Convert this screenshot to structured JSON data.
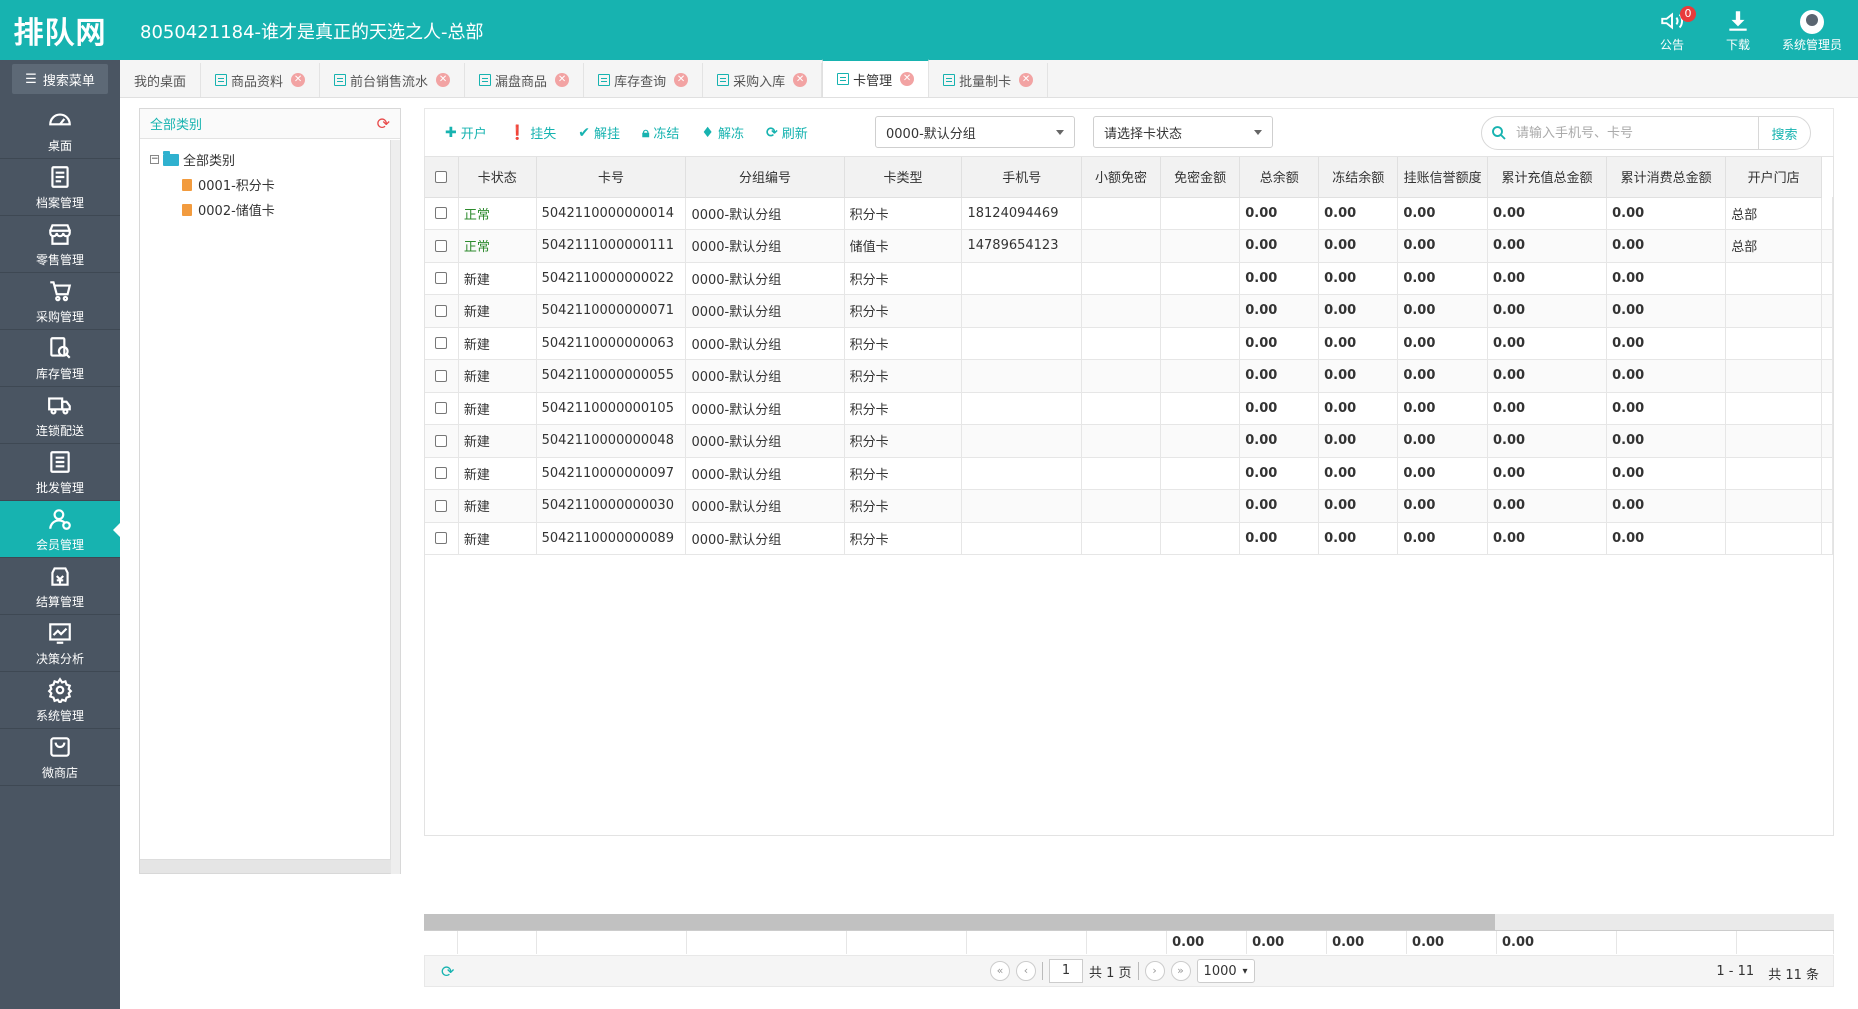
{
  "header": {
    "logo": "排队网",
    "title": "8050421184-谁才是真正的天选之人-总部",
    "actions": [
      {
        "label": "公告",
        "icon": "speaker-icon",
        "badge": "0"
      },
      {
        "label": "下载",
        "icon": "download-icon"
      },
      {
        "label": "系统管理员",
        "icon": "avatar"
      }
    ]
  },
  "sidebar": {
    "search_label": "搜索菜单",
    "items": [
      {
        "label": "桌面",
        "icon": "dashboard-icon"
      },
      {
        "label": "档案管理",
        "icon": "archive-icon"
      },
      {
        "label": "零售管理",
        "icon": "store-icon"
      },
      {
        "label": "采购管理",
        "icon": "cart-icon"
      },
      {
        "label": "库存管理",
        "icon": "inventory-search-icon"
      },
      {
        "label": "连锁配送",
        "icon": "truck-icon"
      },
      {
        "label": "批发管理",
        "icon": "wholesale-icon"
      },
      {
        "label": "会员管理",
        "icon": "member-icon",
        "active": true
      },
      {
        "label": "结算管理",
        "icon": "settlement-icon"
      },
      {
        "label": "决策分析",
        "icon": "chart-icon"
      },
      {
        "label": "系统管理",
        "icon": "gear-icon"
      },
      {
        "label": "微商店",
        "icon": "shop-bag-icon"
      }
    ]
  },
  "tabs": [
    {
      "label": "我的桌面",
      "closable": false
    },
    {
      "label": "商品资料",
      "closable": true
    },
    {
      "label": "前台销售流水",
      "closable": true
    },
    {
      "label": "漏盘商品",
      "closable": true
    },
    {
      "label": "库存查询",
      "closable": true
    },
    {
      "label": "采购入库",
      "closable": true
    },
    {
      "label": "卡管理",
      "closable": true,
      "active": true
    },
    {
      "label": "批量制卡",
      "closable": true
    }
  ],
  "tree": {
    "header": "全部类别",
    "root": "全部类别",
    "children": [
      "0001-积分卡",
      "0002-储值卡"
    ]
  },
  "toolbar": {
    "buttons": [
      {
        "label": "开户",
        "icon": "plus-icon"
      },
      {
        "label": "挂失",
        "icon": "info-icon"
      },
      {
        "label": "解挂",
        "icon": "check-icon"
      },
      {
        "label": "冻结",
        "icon": "lock-icon"
      },
      {
        "label": "解冻",
        "icon": "flame-icon"
      },
      {
        "label": "刷新",
        "icon": "refresh-icon"
      }
    ],
    "group_select": "0000-默认分组",
    "status_select": "请选择卡状态",
    "search_placeholder": "请输入手机号、卡号",
    "search_button": "搜索"
  },
  "table": {
    "columns": [
      "卡状态",
      "卡号",
      "分组编号",
      "卡类型",
      "手机号",
      "小额免密",
      "免密金额",
      "总余额",
      "冻结余额",
      "挂账信誉额度",
      "累计充值总金额",
      "累计消费总金额",
      "开户门店"
    ],
    "rows": [
      [
        "正常",
        "5042110000000014",
        "0000-默认分组",
        "积分卡",
        "18124094469",
        "",
        "",
        "0.00",
        "0.00",
        "0.00",
        "0.00",
        "0.00",
        "总部"
      ],
      [
        "正常",
        "5042111000000111",
        "0000-默认分组",
        "储值卡",
        "14789654123",
        "",
        "",
        "0.00",
        "0.00",
        "0.00",
        "0.00",
        "0.00",
        "总部"
      ],
      [
        "新建",
        "5042110000000022",
        "0000-默认分组",
        "积分卡",
        "",
        "",
        "",
        "0.00",
        "0.00",
        "0.00",
        "0.00",
        "0.00",
        ""
      ],
      [
        "新建",
        "5042110000000071",
        "0000-默认分组",
        "积分卡",
        "",
        "",
        "",
        "0.00",
        "0.00",
        "0.00",
        "0.00",
        "0.00",
        ""
      ],
      [
        "新建",
        "5042110000000063",
        "0000-默认分组",
        "积分卡",
        "",
        "",
        "",
        "0.00",
        "0.00",
        "0.00",
        "0.00",
        "0.00",
        ""
      ],
      [
        "新建",
        "5042110000000055",
        "0000-默认分组",
        "积分卡",
        "",
        "",
        "",
        "0.00",
        "0.00",
        "0.00",
        "0.00",
        "0.00",
        ""
      ],
      [
        "新建",
        "5042110000000105",
        "0000-默认分组",
        "积分卡",
        "",
        "",
        "",
        "0.00",
        "0.00",
        "0.00",
        "0.00",
        "0.00",
        ""
      ],
      [
        "新建",
        "5042110000000048",
        "0000-默认分组",
        "积分卡",
        "",
        "",
        "",
        "0.00",
        "0.00",
        "0.00",
        "0.00",
        "0.00",
        ""
      ],
      [
        "新建",
        "5042110000000097",
        "0000-默认分组",
        "积分卡",
        "",
        "",
        "",
        "0.00",
        "0.00",
        "0.00",
        "0.00",
        "0.00",
        ""
      ],
      [
        "新建",
        "5042110000000030",
        "0000-默认分组",
        "积分卡",
        "",
        "",
        "",
        "0.00",
        "0.00",
        "0.00",
        "0.00",
        "0.00",
        ""
      ],
      [
        "新建",
        "5042110000000089",
        "0000-默认分组",
        "积分卡",
        "",
        "",
        "",
        "0.00",
        "0.00",
        "0.00",
        "0.00",
        "0.00",
        ""
      ]
    ],
    "footer": [
      "",
      "",
      "",
      "",
      "",
      "",
      "0.00",
      "0.00",
      "0.00",
      "0.00",
      "0.00",
      ""
    ]
  },
  "pager": {
    "page": "1",
    "total_pages": "共 1 页",
    "page_size": "1000",
    "range": "1 - 11",
    "total": "共 11 条"
  },
  "colors": {
    "accent": "#17b3b0",
    "sidebar": "#4a5562",
    "status_normal": "#2e8b2e"
  }
}
